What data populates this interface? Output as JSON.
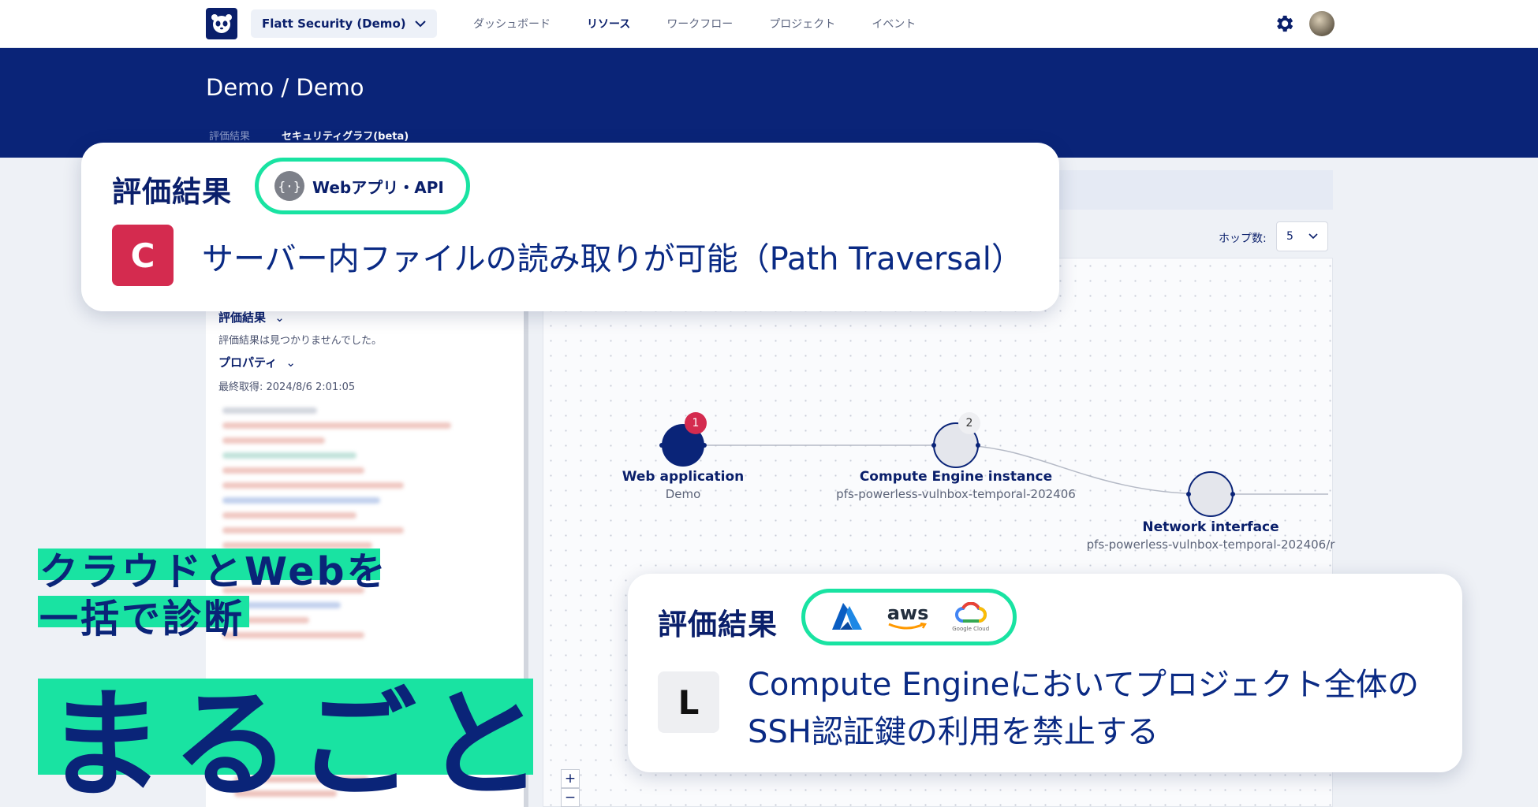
{
  "header": {
    "org_selector": "Flatt Security (Demo)",
    "nav": [
      "ダッシュボード",
      "リソース",
      "ワークフロー",
      "プロジェクト",
      "イベント"
    ],
    "active_nav": "リソース"
  },
  "banner": {
    "breadcrumb": "Demo / Demo",
    "tabs": [
      "評価結果",
      "セキュリティグラフ(beta)"
    ],
    "active_tab": "セキュリティグラフ(beta)"
  },
  "left_panel": {
    "results_heading": "評価結果",
    "results_empty": "評価結果は見つかりませんでした。",
    "properties_heading": "プロパティ",
    "last_fetched": "最終取得: 2024/8/6 2:01:05"
  },
  "graph": {
    "hop_label": "ホップ数:",
    "hop_value": "5",
    "zoom_in": "+",
    "zoom_out": "−",
    "nodes": [
      {
        "title": "Web application",
        "subtitle": "Demo",
        "badge": "1"
      },
      {
        "title": "Compute Engine instance",
        "subtitle": "pfs-powerless-vulnbox-temporal-202406",
        "badge": "2"
      },
      {
        "title": "Network interface",
        "subtitle": "pfs-powerless-vulnbox-temporal-202406/r"
      }
    ]
  },
  "card_web": {
    "title": "評価結果",
    "pill_label": "Webアプリ・API",
    "grade": "C",
    "finding": "サーバー内ファイルの読み取りが可能（Path Traversal）"
  },
  "card_cloud": {
    "title": "評価結果",
    "providers": [
      "Azure",
      "aws",
      "Google Cloud"
    ],
    "grade": "L",
    "finding_line1": "Compute Engineにおいてプロジェクト全体の",
    "finding_line2": "SSH認証鍵の利用を禁止する"
  },
  "promo": {
    "line1": "クラウドとWebを",
    "line2": "一括で診断",
    "big": "まるごと"
  },
  "colors": {
    "navy": "#0a2478",
    "accent_green": "#19e3a2",
    "grade_c": "#d42b4f",
    "badge_red": "#d42b4f"
  }
}
